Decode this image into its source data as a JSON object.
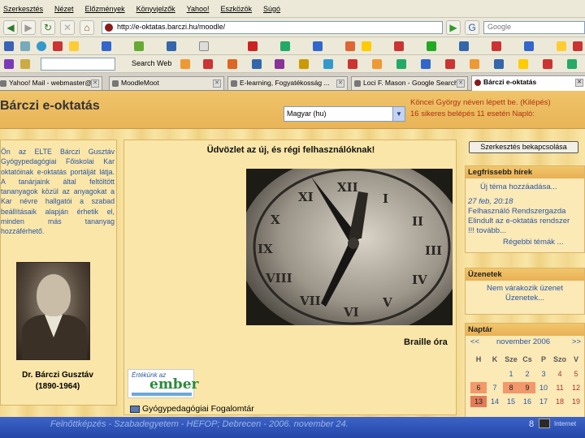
{
  "browser": {
    "menu": [
      "Szerkesztés",
      "Nézet",
      "Előzmények",
      "Könyvjelzők",
      "Yahoo!",
      "Eszközök",
      "Súgó"
    ],
    "url": "http://e-oktatas.barczi.hu/moodle/",
    "search_placeholder": "Google",
    "toolbar_search_label": "Search Web",
    "tabs": [
      {
        "label": "Yahoo! Mail - webmaster@...",
        "active": false
      },
      {
        "label": "MoodleMoot",
        "active": false
      },
      {
        "label": "E-learning, Fogyatékosság ...",
        "active": false
      },
      {
        "label": "Loci F. Mason - Google Search",
        "active": false
      },
      {
        "label": "Bárczi e-oktatás",
        "active": true
      }
    ]
  },
  "site": {
    "title": "Bárczi e-oktatás",
    "language": "Magyar (hu)",
    "login_line1": "Köncei György néven lépett be. (Kilépés)",
    "login_line2": "16 sikeres belépés 11 esetén Napló:"
  },
  "left": {
    "intro": "Ön az ELTE Bárczi Gusztáv Gyógypedagógiai Főiskolai Kar oktatóinak e-oktatás portálját látja. A tanárjaink által feltöltött tananyagok közül az anyagokat a Kar névre hallgatói a szabad beállításaik alapján érhetik el, minden más tananyag hozzáférhető.",
    "portrait_name": "Dr. Bárczi Gusztáv",
    "portrait_years": "(1890-1964)"
  },
  "center": {
    "welcome": "Üdvözlet az új, és régi felhasználóknak!",
    "image_caption": "Braille óra",
    "logo_line1": "Értékünk az",
    "logo_line2": "ember",
    "link": "Gyógypedagógiai Fogalomtár"
  },
  "right": {
    "edit_button": "Szerkesztés bekapcsolása",
    "news": {
      "title": "Legfrissebb hírek",
      "add_link": "Új téma hozzáadása...",
      "date": "27 feb, 20:18",
      "author": "Felhasználó Rendszergazda",
      "text1": "Elindult az e-oktatás rendszer",
      "text2": "!!! tovább...",
      "more": "Régebbi témák ..."
    },
    "messages": {
      "title": "Üzenetek",
      "line1": "Nem várakozik üzenet",
      "line2": "Üzenetek..."
    },
    "calendar": {
      "title": "Naptár",
      "prev": "<<",
      "month": "november 2006",
      "next": ">>",
      "weekdays": [
        "H",
        "K",
        "Sze",
        "Cs",
        "P",
        "Szo",
        "V"
      ],
      "rows": [
        [
          "",
          "",
          "1",
          "2",
          "3",
          "4",
          "5"
        ],
        [
          "6",
          "7",
          "8",
          "9",
          "10",
          "11",
          "12"
        ],
        [
          "13",
          "14",
          "15",
          "16",
          "17",
          "18",
          "19"
        ]
      ]
    }
  },
  "footer": {
    "text": "Felnőttképzés - Szabadegyetem - HEFOP; Debrecen - 2006. november 24.",
    "page": "8",
    "zone": "Internet"
  }
}
